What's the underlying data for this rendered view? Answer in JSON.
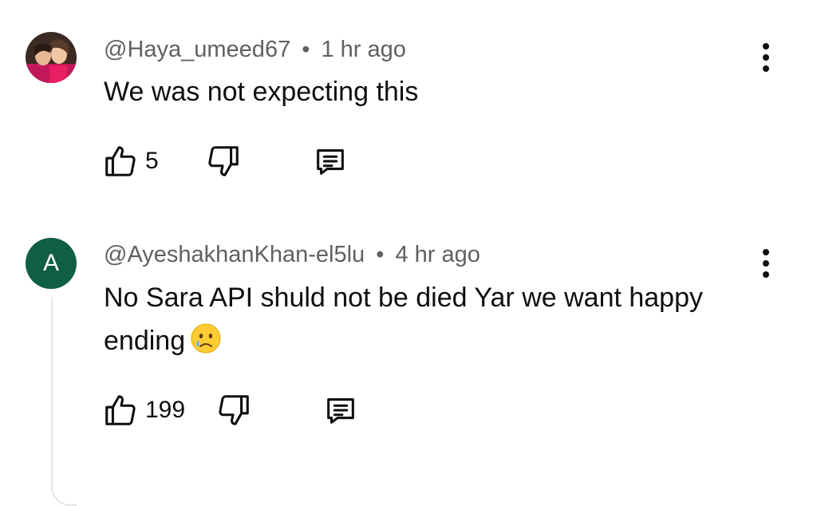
{
  "comments": [
    {
      "author": "@Haya_umeed67",
      "separator": "•",
      "time": "1 hr ago",
      "text": "We was not expecting this",
      "likes": "5",
      "avatar": {
        "type": "photo",
        "colors": [
          "#c2185b",
          "#f3c6a5",
          "#3b2a22"
        ]
      }
    },
    {
      "author": "@AyeshakhanKhan-el5lu",
      "separator": "•",
      "time": "4 hr ago",
      "text": "No Sara API shuld not be died Yar we want happy ending",
      "emoji": "crying-face",
      "likes": "199",
      "avatar": {
        "type": "letter",
        "letter": "A",
        "color": "#0f5e46"
      }
    }
  ],
  "icons": {
    "like": "thumbs-up-icon",
    "dislike": "thumbs-down-icon",
    "reply": "reply-comment-icon",
    "menu": "more-vertical-icon"
  }
}
